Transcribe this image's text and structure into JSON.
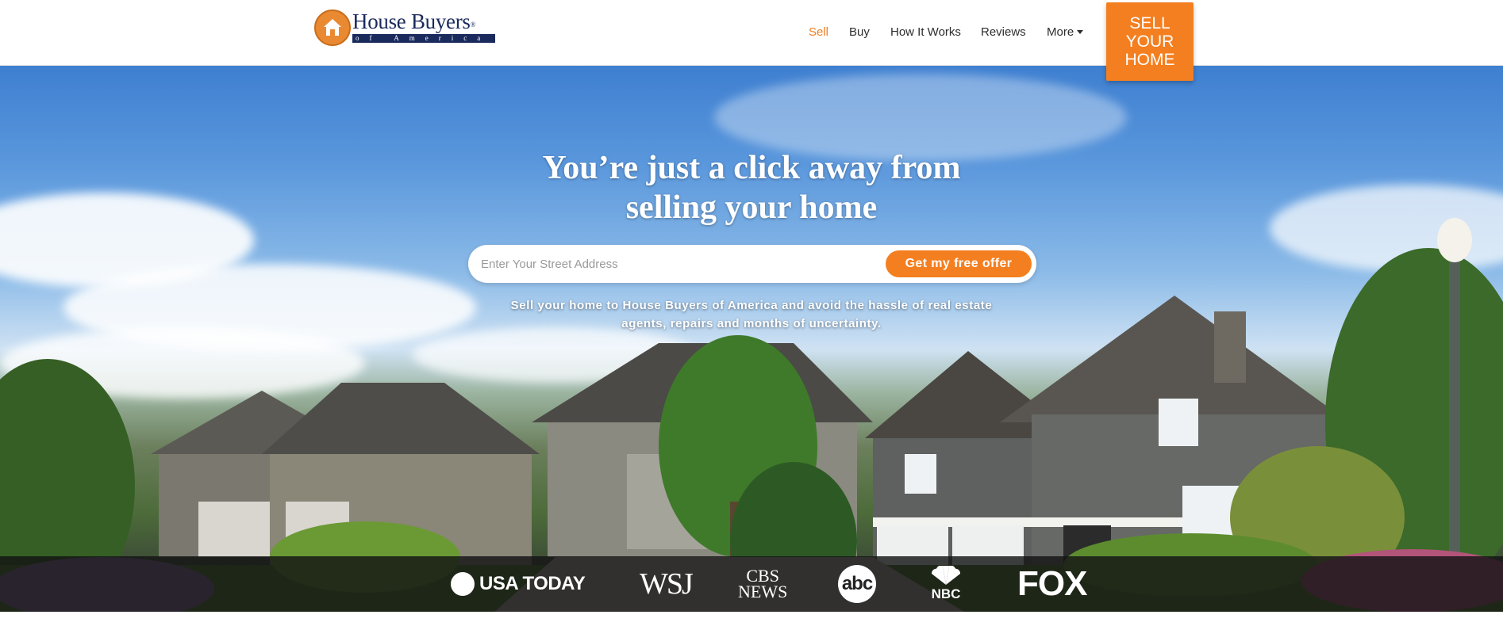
{
  "brand": {
    "name": "House Buyers",
    "tagline": "of America",
    "registered": "®"
  },
  "nav": {
    "items": [
      {
        "label": "Sell",
        "active": true
      },
      {
        "label": "Buy",
        "active": false
      },
      {
        "label": "How It Works",
        "active": false
      },
      {
        "label": "Reviews",
        "active": false
      },
      {
        "label": "More",
        "active": false
      }
    ],
    "cta_label": "SELL YOUR HOME"
  },
  "hero": {
    "headline_line1": "You’re just a click away from",
    "headline_line2": "selling your home",
    "search_placeholder": "Enter Your Street Address",
    "search_button": "Get my free offer",
    "subtext_line1": "Sell your home to House Buyers of America and avoid the hassle of real estate",
    "subtext_line2": "agents, repairs and months of uncertainty."
  },
  "press": {
    "logos": [
      "USA TODAY",
      "WSJ",
      "CBS NEWS",
      "abc",
      "NBC",
      "FOX"
    ],
    "cbs_line1": "CBS",
    "cbs_line2": "NEWS"
  },
  "colors": {
    "accent": "#f47f20",
    "navy": "#1b2a5c"
  },
  "icons": {
    "logo": "house-icon",
    "more": "caret-down-icon"
  }
}
